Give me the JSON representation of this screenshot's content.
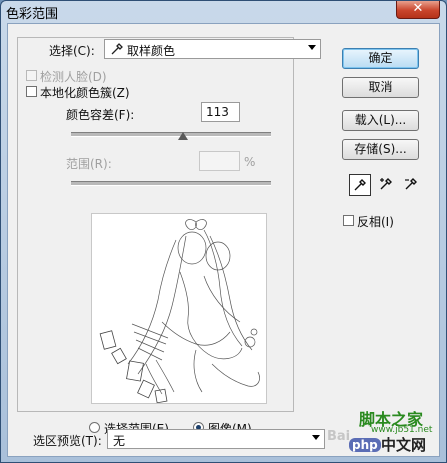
{
  "window": {
    "title": "色彩范围",
    "close_glyph": "✕"
  },
  "select": {
    "label": "选择(C):",
    "value": "取样颜色",
    "icon": "eyedropper-icon"
  },
  "detect_faces": {
    "label": "检测人脸(D)",
    "checked": false,
    "enabled": false
  },
  "localized_clusters": {
    "label": "本地化颜色簇(Z)",
    "checked": false
  },
  "fuzziness": {
    "label": "颜色容差(F):",
    "value": "113",
    "slider_fraction": 0.56
  },
  "range": {
    "label": "范围(R):",
    "value": "",
    "unit": "%",
    "enabled": false
  },
  "view": {
    "selection_label": "选择范围(E)",
    "image_label": "图像(M)",
    "selected": "image"
  },
  "buttons": {
    "ok": "确定",
    "cancel": "取消",
    "load": "载入(L)...",
    "save": "存储(S)..."
  },
  "eyedroppers": [
    {
      "name": "eyedropper-icon",
      "active": true
    },
    {
      "name": "eyedropper-plus-icon",
      "active": false
    },
    {
      "name": "eyedropper-minus-icon",
      "active": false
    }
  ],
  "invert": {
    "label": "反相(I)",
    "checked": false
  },
  "selection_preview": {
    "label": "选区预览(T):",
    "value": "无"
  },
  "watermark": {
    "jb51": "脚本之家",
    "jb51_url": "www.jb51.net",
    "baidu": "Bai",
    "php": "php",
    "php_cn": "中文网"
  },
  "colors": {
    "title_gradient_top": "#c9d9ea",
    "client_bg": "#f0f0f0",
    "close_red": "#c9452c",
    "default_btn": "#b9dcf3",
    "watermark_green": "#2a8a1f",
    "php_purple": "#5b6db5"
  }
}
